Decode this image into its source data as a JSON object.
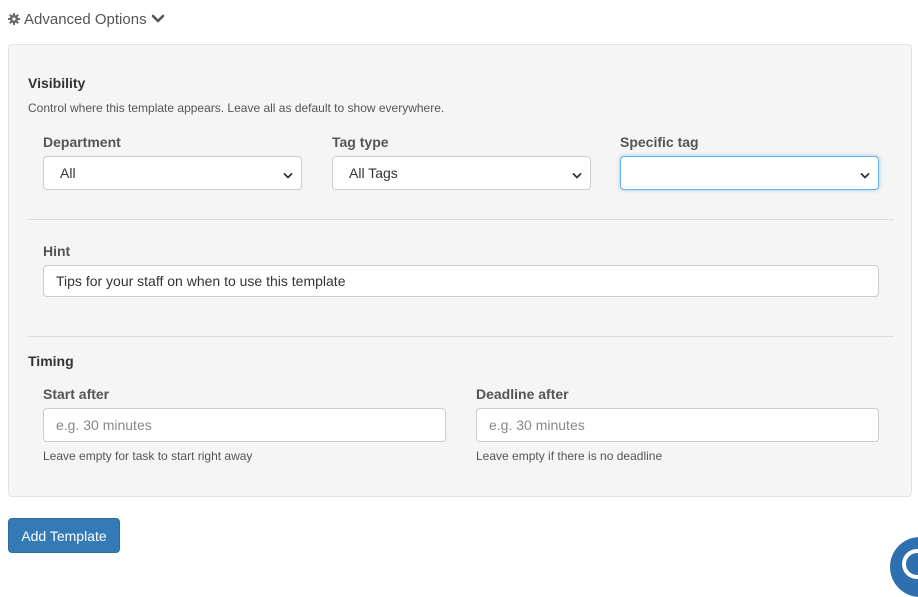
{
  "advanced_options": {
    "label": "Advanced Options"
  },
  "visibility": {
    "title": "Visibility",
    "help": "Control where this template appears. Leave all as default to show everywhere.",
    "department": {
      "label": "Department",
      "value": "All"
    },
    "tag_type": {
      "label": "Tag type",
      "value": "All Tags"
    },
    "specific_tag": {
      "label": "Specific tag",
      "value": ""
    }
  },
  "hint": {
    "label": "Hint",
    "value": "Tips for your staff on when to use this template"
  },
  "timing": {
    "title": "Timing",
    "start_after": {
      "label": "Start after",
      "placeholder": "e.g. 30 minutes",
      "help": "Leave empty for task to start right away"
    },
    "deadline_after": {
      "label": "Deadline after",
      "placeholder": "e.g. 30 minutes",
      "help": "Leave empty if there is no deadline"
    }
  },
  "actions": {
    "add_template_label": "Add Template"
  },
  "colors": {
    "primary": "#337ab7",
    "panel_bg": "#f5f5f5",
    "focus": "#66afe9"
  }
}
